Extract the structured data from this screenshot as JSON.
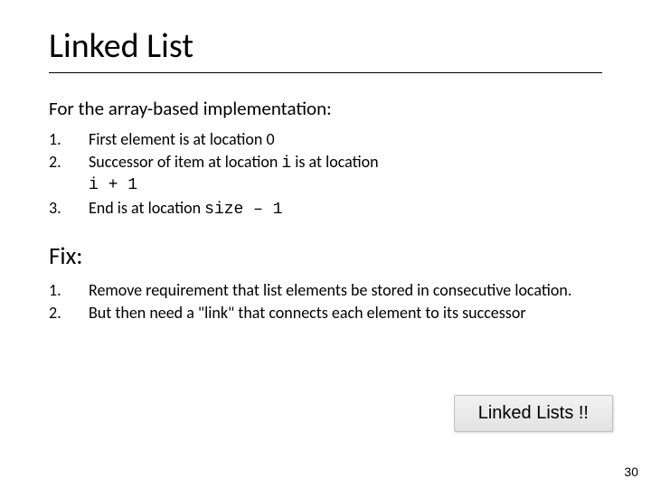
{
  "title": "Linked List",
  "sub1": "For the array-based implementation:",
  "list1": {
    "n1": "1.",
    "t1a": "First element is at location 0",
    "n2": "2.",
    "t2a": "Successor of item at location ",
    "t2code1": "i",
    "t2b": " is at location ",
    "t2code2": "i + 1",
    "n3": "3.",
    "t3a": "End is at location ",
    "t3code": "size – 1"
  },
  "fix_head": "Fix:",
  "list2": {
    "n1": "1.",
    "t1": "Remove requirement that list elements be stored in consecutive location.",
    "n2": "2.",
    "t2": "But then need a \"link\" that connects each element to its successor"
  },
  "callout": "Linked Lists !!",
  "page_number": "30"
}
